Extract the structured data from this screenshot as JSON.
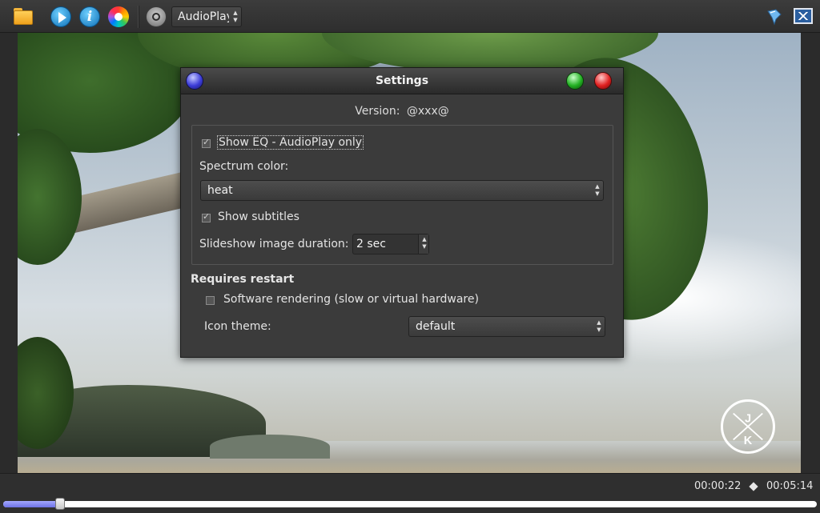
{
  "toolbar": {
    "icons": [
      "folder-icon",
      "play-icon",
      "info-icon",
      "color-wheel-icon",
      "speaker-icon",
      "pin-icon",
      "fullscreen-icon"
    ],
    "mode_select_value": "AudioPlay"
  },
  "dialog": {
    "title": "Settings",
    "version_label": "Version:",
    "version_value": "@xxx@",
    "show_eq_label": "Show EQ - AudioPlay only",
    "show_eq_checked": true,
    "spectrum_color_label": "Spectrum color:",
    "spectrum_color_value": "heat",
    "show_subtitles_label": "Show subtitles",
    "show_subtitles_checked": true,
    "slideshow_duration_label": "Slideshow image duration:",
    "slideshow_duration_value": "2 sec",
    "requires_restart_label": "Requires restart",
    "software_rendering_label": "Software rendering (slow or virtual hardware)",
    "software_rendering_checked": false,
    "icon_theme_label": "Icon theme:",
    "icon_theme_value": "default"
  },
  "playback": {
    "elapsed": "00:00:22",
    "total": "00:05:14",
    "progress_fraction": 0.07
  },
  "colors": {
    "accent_progress": "#7e82f0",
    "window_bg": "#3b3b3b"
  }
}
